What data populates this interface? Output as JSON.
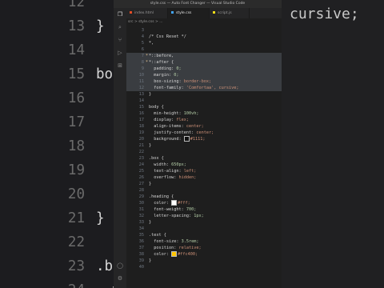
{
  "window": {
    "title": "style.css — Auto Font Changer — Visual Studio Code"
  },
  "tabs": [
    {
      "label": "index.html",
      "active": false,
      "dot": "#e44d26"
    },
    {
      "label": "style.css",
      "active": true,
      "dot": "#42a5f5"
    },
    {
      "label": "script.js",
      "active": false,
      "dot": "#f5de19"
    }
  ],
  "breadcrumb": "src > style.css > ...",
  "activity_icons": [
    "files-icon",
    "search-icon",
    "source-control-icon",
    "run-debug-icon",
    "extensions-icon",
    "account-icon",
    "settings-icon"
  ],
  "lines": [
    {
      "n": "3",
      "code": ""
    },
    {
      "n": "4",
      "code": "/* Css Reset */",
      "cls": "c-com"
    },
    {
      "n": "5",
      "code": "*,",
      "cls": "c-sel"
    },
    {
      "n": "6",
      "code": ""
    },
    {
      "n": "7",
      "code": "*::before,",
      "cls": "c-sel",
      "hl": true,
      "mark": "*"
    },
    {
      "n": "8",
      "code": "*::after {",
      "cls": "c-sel",
      "hl": true,
      "mark": "*"
    },
    {
      "n": "9",
      "code": "  padding: 0;",
      "cls": "c-prop",
      "hl": true
    },
    {
      "n": "10",
      "code": "  margin: 0;",
      "cls": "c-prop",
      "hl": true
    },
    {
      "n": "11",
      "code": "  box-sizing: border-box;",
      "cls": "c-prop",
      "hl": true
    },
    {
      "n": "12",
      "code": "  font-family: 'Comfortaa', cursive;",
      "cls": "c-prop",
      "hl": true
    },
    {
      "n": "13",
      "code": "}",
      "cls": "c-br"
    },
    {
      "n": "14",
      "code": ""
    },
    {
      "n": "15",
      "code": "body {",
      "cls": "c-sel"
    },
    {
      "n": "16",
      "code": "  min-height: 100vh;",
      "cls": "c-prop"
    },
    {
      "n": "17",
      "code": "  display: flex;",
      "cls": "c-prop"
    },
    {
      "n": "18",
      "code": "  align-items: center;",
      "cls": "c-prop"
    },
    {
      "n": "19",
      "code": "  justify-content: center;",
      "cls": "c-prop"
    },
    {
      "n": "20",
      "code": "  background: #1111;",
      "cls": "c-prop",
      "swatch": "#111111"
    },
    {
      "n": "21",
      "code": "}",
      "cls": "c-br"
    },
    {
      "n": "22",
      "code": ""
    },
    {
      "n": "23",
      "code": ".box {",
      "cls": "c-sel"
    },
    {
      "n": "24",
      "code": "  width: 650px;",
      "cls": "c-prop"
    },
    {
      "n": "25",
      "code": "  text-align: left;",
      "cls": "c-prop"
    },
    {
      "n": "26",
      "code": "  overflow: hidden;",
      "cls": "c-prop"
    },
    {
      "n": "27",
      "code": "}",
      "cls": "c-br"
    },
    {
      "n": "28",
      "code": ""
    },
    {
      "n": "29",
      "code": ".heading {",
      "cls": "c-sel"
    },
    {
      "n": "30",
      "code": "  color: #fff;",
      "cls": "c-prop",
      "swatch": "#ffffff"
    },
    {
      "n": "31",
      "code": "  font-weight: 700;",
      "cls": "c-prop"
    },
    {
      "n": "32",
      "code": "  letter-spacing: 1px;",
      "cls": "c-prop"
    },
    {
      "n": "33",
      "code": "}",
      "cls": "c-br"
    },
    {
      "n": "34",
      "code": ""
    },
    {
      "n": "35",
      "code": ".text {",
      "cls": "c-sel"
    },
    {
      "n": "36",
      "code": "  font-size: 3.5rem;",
      "cls": "c-prop"
    },
    {
      "n": "37",
      "code": "  position: relative;",
      "cls": "c-prop"
    },
    {
      "n": "38",
      "code": "  color: #ffc400;",
      "cls": "c-prop",
      "swatch": "#ffc400"
    },
    {
      "n": "39",
      "code": "}",
      "cls": "c-br"
    },
    {
      "n": "40",
      "code": ""
    }
  ],
  "background_left": [
    {
      "n": "12",
      "code": "    font-family: 'Comfortaa', cursive;"
    },
    {
      "n": "13",
      "code": "}"
    },
    {
      "n": "14",
      "code": ""
    },
    {
      "n": "15",
      "code": "body {"
    },
    {
      "n": "16",
      "code": "  min-height: 100vh;"
    },
    {
      "n": "17",
      "code": "  display: flex;"
    },
    {
      "n": "18",
      "code": "  align-items: center;"
    },
    {
      "n": "19",
      "code": "  justify-content: center;"
    },
    {
      "n": "20",
      "code": "  background: #1111;"
    },
    {
      "n": "21",
      "code": "}"
    },
    {
      "n": "22",
      "code": ""
    },
    {
      "n": "23",
      "code": ".box {"
    },
    {
      "n": "24",
      "code": "  width: 650px;"
    }
  ],
  "background_right_fragment": "cursive;"
}
